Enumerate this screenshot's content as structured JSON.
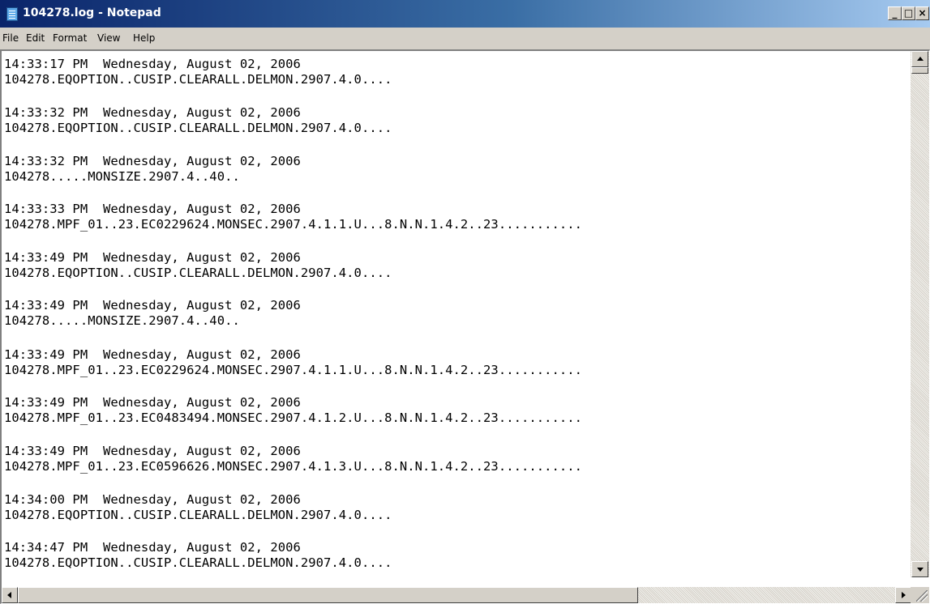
{
  "window": {
    "title": "104278.log - Notepad",
    "minimize_label": "_",
    "maximize_label": "□",
    "close_label": "×"
  },
  "menu": {
    "items": [
      "File",
      "Edit",
      "Format",
      "View",
      "Help"
    ]
  },
  "document": {
    "entries": [
      {
        "time": "14:33:17 PM  Wednesday, August 02, 2006",
        "data": "104278.EQOPTION..CUSIP.CLEARALL.DELMON.2907.4.0...."
      },
      {
        "time": "14:33:32 PM  Wednesday, August 02, 2006",
        "data": "104278.EQOPTION..CUSIP.CLEARALL.DELMON.2907.4.0...."
      },
      {
        "time": "14:33:32 PM  Wednesday, August 02, 2006",
        "data": "104278.....MONSIZE.2907.4..40.."
      },
      {
        "time": "14:33:33 PM  Wednesday, August 02, 2006",
        "data": "104278.MPF_01..23.EC0229624.MONSEC.2907.4.1.1.U...8.N.N.1.4.2..23..........."
      },
      {
        "time": "14:33:49 PM  Wednesday, August 02, 2006",
        "data": "104278.EQOPTION..CUSIP.CLEARALL.DELMON.2907.4.0...."
      },
      {
        "time": "14:33:49 PM  Wednesday, August 02, 2006",
        "data": "104278.....MONSIZE.2907.4..40.."
      },
      {
        "time": "14:33:49 PM  Wednesday, August 02, 2006",
        "data": "104278.MPF_01..23.EC0229624.MONSEC.2907.4.1.1.U...8.N.N.1.4.2..23..........."
      },
      {
        "time": "14:33:49 PM  Wednesday, August 02, 2006",
        "data": "104278.MPF_01..23.EC0483494.MONSEC.2907.4.1.2.U...8.N.N.1.4.2..23..........."
      },
      {
        "time": "14:33:49 PM  Wednesday, August 02, 2006",
        "data": "104278.MPF_01..23.EC0596626.MONSEC.2907.4.1.3.U...8.N.N.1.4.2..23..........."
      },
      {
        "time": "14:34:00 PM  Wednesday, August 02, 2006",
        "data": "104278.EQOPTION..CUSIP.CLEARALL.DELMON.2907.4.0...."
      },
      {
        "time": "14:34:47 PM  Wednesday, August 02, 2006",
        "data": "104278.EQOPTION..CUSIP.CLEARALL.DELMON.2907.4.0...."
      }
    ]
  },
  "colors": {
    "titlebar_start": "#0a246a",
    "titlebar_end": "#a6caf0",
    "chrome": "#d4d0c8",
    "editor_bg": "#ffffff"
  },
  "icons": {
    "app": "notepad-icon",
    "scroll_up": "arrow-up-icon",
    "scroll_down": "arrow-down-icon",
    "scroll_left": "arrow-left-icon",
    "scroll_right": "arrow-right-icon",
    "resize": "resize-grip-icon"
  }
}
